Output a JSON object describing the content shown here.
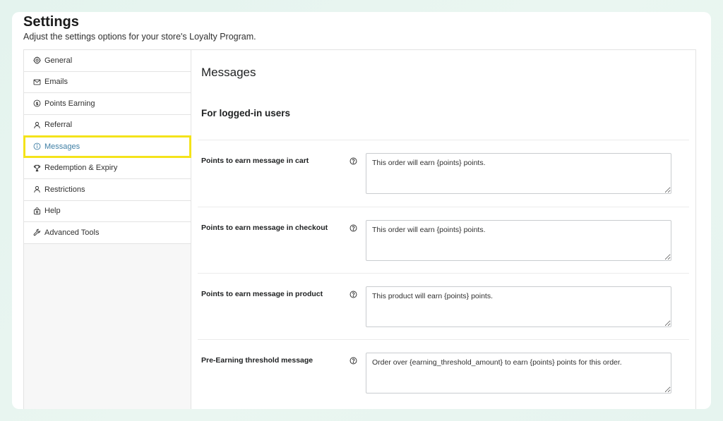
{
  "header": {
    "title": "Settings",
    "subtitle": "Adjust the settings options for your store's Loyalty Program."
  },
  "sidebar": {
    "items": [
      {
        "label": "General",
        "icon": "gear-icon",
        "active": false
      },
      {
        "label": "Emails",
        "icon": "mail-icon",
        "active": false
      },
      {
        "label": "Points Earning",
        "icon": "dollar-coin-icon",
        "active": false
      },
      {
        "label": "Referral",
        "icon": "person-icon",
        "active": false
      },
      {
        "label": "Messages",
        "icon": "info-circle-icon",
        "active": true
      },
      {
        "label": "Redemption & Expiry",
        "icon": "trophy-icon",
        "active": false
      },
      {
        "label": "Restrictions",
        "icon": "person-icon",
        "active": false
      },
      {
        "label": "Help",
        "icon": "lifebuoy-icon",
        "active": false
      },
      {
        "label": "Advanced Tools",
        "icon": "wrench-icon",
        "active": false
      }
    ]
  },
  "main": {
    "section_title": "Messages",
    "group_title": "For logged-in users",
    "fields": [
      {
        "label": "Points to earn message in cart",
        "value": "This order will earn {points} points."
      },
      {
        "label": "Points to earn message in checkout",
        "value": "This order will earn {points} points."
      },
      {
        "label": "Points to earn message in product",
        "value": "This product will earn {points} points."
      },
      {
        "label": "Pre-Earning threshold message",
        "value": "Order over {earning_threshold_amount} to earn {points} points for this order."
      }
    ]
  },
  "colors": {
    "active_nav_text": "#3f7fa5",
    "highlight_box": "#f4e31a",
    "background": "#e4f3ee"
  }
}
